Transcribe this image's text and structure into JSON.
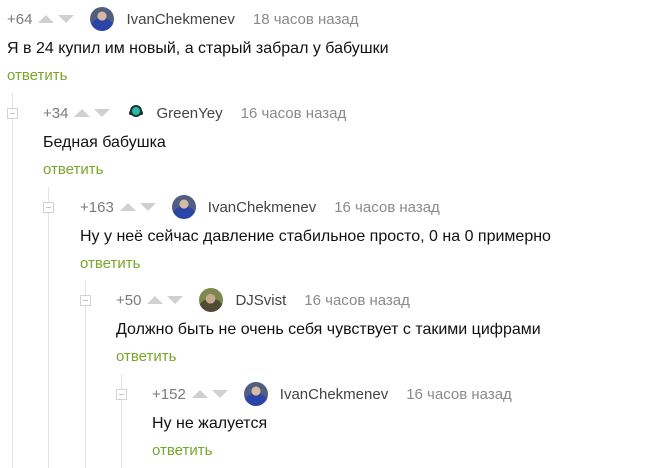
{
  "comments": [
    {
      "rating": "+64",
      "username": "IvanChekmenev",
      "time": "18 часов назад",
      "text": "Я в 24 купил им новый, а старый забрал у бабушки",
      "reply": "ответить",
      "avatar": "avatar-ivan"
    },
    {
      "rating": "+34",
      "username": "GreenYey",
      "time": "16 часов назад",
      "text": "Бедная бабушка",
      "reply": "ответить",
      "avatar": "avatar-greenyey"
    },
    {
      "rating": "+163",
      "username": "IvanChekmenev",
      "time": "16 часов назад",
      "text": "Ну у неё сейчас давление стабильное просто, 0 на 0 примерно",
      "reply": "ответить",
      "avatar": "avatar-ivan"
    },
    {
      "rating": "+50",
      "username": "DJSvist",
      "time": "16 часов назад",
      "text": "Должно быть не очень себя чувствует с такими цифрами",
      "reply": "ответить",
      "avatar": "avatar-djsvist"
    },
    {
      "rating": "+152",
      "username": "IvanChekmenev",
      "time": "16 часов назад",
      "text": "Ну не жалуется",
      "reply": "ответить",
      "avatar": "avatar-ivan"
    }
  ],
  "colors": {
    "reply": "#7aa52b",
    "meta": "#8a8a8a",
    "text": "#111111"
  }
}
